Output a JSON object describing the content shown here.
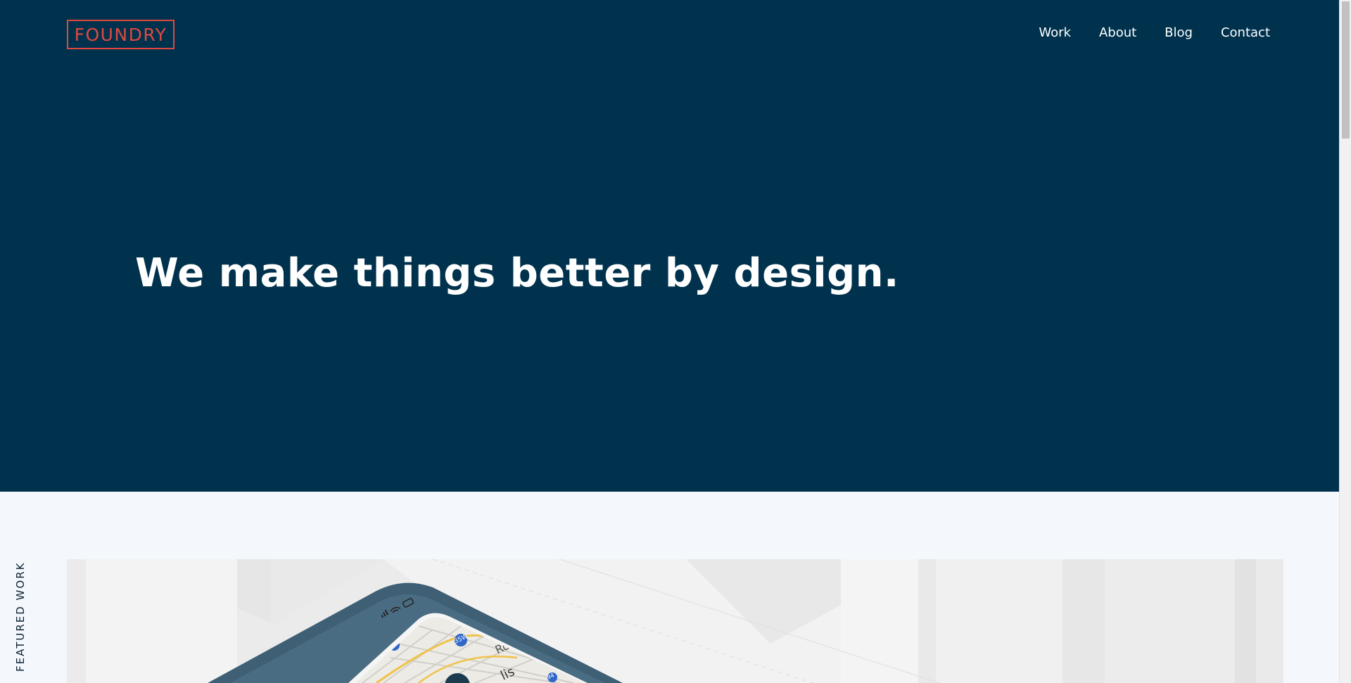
{
  "brand": {
    "logo_text": "FOUNDRY",
    "accent_color": "#e0483e"
  },
  "nav": {
    "items": [
      {
        "label": "Work"
      },
      {
        "label": "About"
      },
      {
        "label": "Blog"
      },
      {
        "label": "Contact"
      }
    ]
  },
  "hero": {
    "headline": "We make things better by design.",
    "background_color": "#00324e"
  },
  "featured": {
    "section_label": "FEATURED WORK",
    "image_icon": "phone-map-illustration",
    "map_labels": [
      "Rose",
      "lis",
      "35W",
      "94"
    ]
  }
}
